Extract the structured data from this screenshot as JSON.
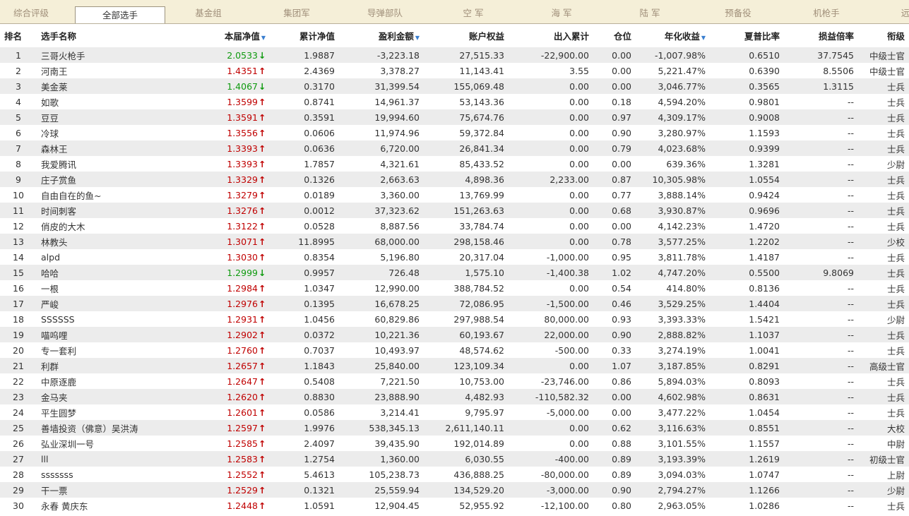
{
  "tabs": [
    {
      "label": "综合评级",
      "active": false
    },
    {
      "label": "全部选手",
      "active": true
    },
    {
      "label": "基金组",
      "active": false
    },
    {
      "label": "集团军",
      "active": false
    },
    {
      "label": "导弹部队",
      "active": false
    },
    {
      "label": "空 军",
      "active": false
    },
    {
      "label": "海 军",
      "active": false
    },
    {
      "label": "陆 军",
      "active": false
    },
    {
      "label": "预备役",
      "active": false
    },
    {
      "label": "机枪手",
      "active": false
    },
    {
      "label": "远",
      "active": false
    }
  ],
  "columns": {
    "rank": "排名",
    "name": "选手名称",
    "nav": "本届净值",
    "cum_nav": "累计净值",
    "profit": "盈利金额",
    "equity": "账户权益",
    "inout": "出入累计",
    "position": "仓位",
    "annual": "年化收益",
    "sharpe": "夏普比率",
    "pl_ratio": "损益倍率",
    "title": "衔级"
  },
  "sort_icon": "▼",
  "colors": {
    "up": "#c00000",
    "down": "#0f9a0f",
    "tab_bg": "#f5efd8",
    "row_alt": "#ececec"
  },
  "rows": [
    {
      "rank": "1",
      "name": "三哥火枪手",
      "nav": "2.0533",
      "dir": "down",
      "cum_nav": "1.9887",
      "profit": "-3,223.18",
      "equity": "27,515.33",
      "inout": "-22,900.00",
      "position": "0.00",
      "annual": "-1,007.98%",
      "sharpe": "0.6510",
      "pl_ratio": "37.7545",
      "title": "中级士官"
    },
    {
      "rank": "2",
      "name": "河南王",
      "nav": "1.4351",
      "dir": "up",
      "cum_nav": "2.4369",
      "profit": "3,378.27",
      "equity": "11,143.41",
      "inout": "3.55",
      "position": "0.00",
      "annual": "5,221.47%",
      "sharpe": "0.6390",
      "pl_ratio": "8.5506",
      "title": "中级士官"
    },
    {
      "rank": "3",
      "name": "美金莱",
      "nav": "1.4067",
      "dir": "down",
      "cum_nav": "0.3170",
      "profit": "31,399.54",
      "equity": "155,069.48",
      "inout": "0.00",
      "position": "0.00",
      "annual": "3,046.77%",
      "sharpe": "0.3565",
      "pl_ratio": "1.3115",
      "title": "士兵"
    },
    {
      "rank": "4",
      "name": "如歌",
      "nav": "1.3599",
      "dir": "up",
      "cum_nav": "0.8741",
      "profit": "14,961.37",
      "equity": "53,143.36",
      "inout": "0.00",
      "position": "0.18",
      "annual": "4,594.20%",
      "sharpe": "0.9801",
      "pl_ratio": "--",
      "title": "士兵"
    },
    {
      "rank": "5",
      "name": "豆豆",
      "nav": "1.3591",
      "dir": "up",
      "cum_nav": "0.3591",
      "profit": "19,994.60",
      "equity": "75,674.76",
      "inout": "0.00",
      "position": "0.97",
      "annual": "4,309.17%",
      "sharpe": "0.9008",
      "pl_ratio": "--",
      "title": "士兵"
    },
    {
      "rank": "6",
      "name": "冷球",
      "nav": "1.3556",
      "dir": "up",
      "cum_nav": "0.0606",
      "profit": "11,974.96",
      "equity": "59,372.84",
      "inout": "0.00",
      "position": "0.90",
      "annual": "3,280.97%",
      "sharpe": "1.1593",
      "pl_ratio": "--",
      "title": "士兵"
    },
    {
      "rank": "7",
      "name": "森林王",
      "nav": "1.3393",
      "dir": "up",
      "cum_nav": "0.0636",
      "profit": "6,720.00",
      "equity": "26,841.34",
      "inout": "0.00",
      "position": "0.79",
      "annual": "4,023.68%",
      "sharpe": "0.9399",
      "pl_ratio": "--",
      "title": "士兵"
    },
    {
      "rank": "8",
      "name": "我爱腾讯",
      "nav": "1.3393",
      "dir": "up",
      "cum_nav": "1.7857",
      "profit": "4,321.61",
      "equity": "85,433.52",
      "inout": "0.00",
      "position": "0.00",
      "annual": "639.36%",
      "sharpe": "1.3281",
      "pl_ratio": "--",
      "title": "少尉"
    },
    {
      "rank": "9",
      "name": "庄子赏鱼",
      "nav": "1.3329",
      "dir": "up",
      "cum_nav": "0.1326",
      "profit": "2,663.63",
      "equity": "4,898.36",
      "inout": "2,233.00",
      "position": "0.87",
      "annual": "10,305.98%",
      "sharpe": "1.0554",
      "pl_ratio": "--",
      "title": "士兵"
    },
    {
      "rank": "10",
      "name": "自由自在的鱼~",
      "nav": "1.3279",
      "dir": "up",
      "cum_nav": "0.0189",
      "profit": "3,360.00",
      "equity": "13,769.99",
      "inout": "0.00",
      "position": "0.77",
      "annual": "3,888.14%",
      "sharpe": "0.9424",
      "pl_ratio": "--",
      "title": "士兵"
    },
    {
      "rank": "11",
      "name": "时间刺客",
      "nav": "1.3276",
      "dir": "up",
      "cum_nav": "0.0012",
      "profit": "37,323.62",
      "equity": "151,263.63",
      "inout": "0.00",
      "position": "0.68",
      "annual": "3,930.87%",
      "sharpe": "0.9696",
      "pl_ratio": "--",
      "title": "士兵"
    },
    {
      "rank": "12",
      "name": "俏皮的大木",
      "nav": "1.3122",
      "dir": "up",
      "cum_nav": "0.0528",
      "profit": "8,887.56",
      "equity": "33,784.74",
      "inout": "0.00",
      "position": "0.00",
      "annual": "4,142.23%",
      "sharpe": "1.4720",
      "pl_ratio": "--",
      "title": "士兵"
    },
    {
      "rank": "13",
      "name": "林教头",
      "nav": "1.3071",
      "dir": "up",
      "cum_nav": "11.8995",
      "profit": "68,000.00",
      "equity": "298,158.46",
      "inout": "0.00",
      "position": "0.78",
      "annual": "3,577.25%",
      "sharpe": "1.2202",
      "pl_ratio": "--",
      "title": "少校"
    },
    {
      "rank": "14",
      "name": "alpd",
      "nav": "1.3030",
      "dir": "up",
      "cum_nav": "0.8354",
      "profit": "5,196.80",
      "equity": "20,317.04",
      "inout": "-1,000.00",
      "position": "0.95",
      "annual": "3,811.78%",
      "sharpe": "1.4187",
      "pl_ratio": "--",
      "title": "士兵"
    },
    {
      "rank": "15",
      "name": "哈哈",
      "nav": "1.2999",
      "dir": "down",
      "cum_nav": "0.9957",
      "profit": "726.48",
      "equity": "1,575.10",
      "inout": "-1,400.38",
      "position": "1.02",
      "annual": "4,747.20%",
      "sharpe": "0.5500",
      "pl_ratio": "9.8069",
      "title": "士兵"
    },
    {
      "rank": "16",
      "name": "一根",
      "nav": "1.2984",
      "dir": "up",
      "cum_nav": "1.0347",
      "profit": "12,990.00",
      "equity": "388,784.52",
      "inout": "0.00",
      "position": "0.54",
      "annual": "414.80%",
      "sharpe": "0.8136",
      "pl_ratio": "--",
      "title": "士兵"
    },
    {
      "rank": "17",
      "name": "严峻",
      "nav": "1.2976",
      "dir": "up",
      "cum_nav": "0.1395",
      "profit": "16,678.25",
      "equity": "72,086.95",
      "inout": "-1,500.00",
      "position": "0.46",
      "annual": "3,529.25%",
      "sharpe": "1.4404",
      "pl_ratio": "--",
      "title": "士兵"
    },
    {
      "rank": "18",
      "name": "SSSSSS",
      "nav": "1.2931",
      "dir": "up",
      "cum_nav": "1.0456",
      "profit": "60,829.86",
      "equity": "297,988.54",
      "inout": "80,000.00",
      "position": "0.93",
      "annual": "3,393.33%",
      "sharpe": "1.5421",
      "pl_ratio": "--",
      "title": "少尉"
    },
    {
      "rank": "19",
      "name": "喵呜哩",
      "nav": "1.2902",
      "dir": "up",
      "cum_nav": "0.0372",
      "profit": "10,221.36",
      "equity": "60,193.67",
      "inout": "22,000.00",
      "position": "0.90",
      "annual": "2,888.82%",
      "sharpe": "1.1037",
      "pl_ratio": "--",
      "title": "士兵"
    },
    {
      "rank": "20",
      "name": "专一套利",
      "nav": "1.2760",
      "dir": "up",
      "cum_nav": "0.7037",
      "profit": "10,493.97",
      "equity": "48,574.62",
      "inout": "-500.00",
      "position": "0.33",
      "annual": "3,274.19%",
      "sharpe": "1.0041",
      "pl_ratio": "--",
      "title": "士兵"
    },
    {
      "rank": "21",
      "name": "利群",
      "nav": "1.2657",
      "dir": "up",
      "cum_nav": "1.1843",
      "profit": "25,840.00",
      "equity": "123,109.34",
      "inout": "0.00",
      "position": "1.07",
      "annual": "3,187.85%",
      "sharpe": "0.8291",
      "pl_ratio": "--",
      "title": "高级士官"
    },
    {
      "rank": "22",
      "name": "中原逐鹿",
      "nav": "1.2647",
      "dir": "up",
      "cum_nav": "0.5408",
      "profit": "7,221.50",
      "equity": "10,753.00",
      "inout": "-23,746.00",
      "position": "0.86",
      "annual": "5,894.03%",
      "sharpe": "0.8093",
      "pl_ratio": "--",
      "title": "士兵"
    },
    {
      "rank": "23",
      "name": "金马夹",
      "nav": "1.2620",
      "dir": "up",
      "cum_nav": "0.8830",
      "profit": "23,888.90",
      "equity": "4,482.93",
      "inout": "-110,582.32",
      "position": "0.00",
      "annual": "4,602.98%",
      "sharpe": "0.8631",
      "pl_ratio": "--",
      "title": "士兵"
    },
    {
      "rank": "24",
      "name": "平生圆梦",
      "nav": "1.2601",
      "dir": "up",
      "cum_nav": "0.0586",
      "profit": "3,214.41",
      "equity": "9,795.97",
      "inout": "-5,000.00",
      "position": "0.00",
      "annual": "3,477.22%",
      "sharpe": "1.0454",
      "pl_ratio": "--",
      "title": "士兵"
    },
    {
      "rank": "25",
      "name": "善墙投资（佛意）吴洪涛",
      "nav": "1.2597",
      "dir": "up",
      "cum_nav": "1.9976",
      "profit": "538,345.13",
      "equity": "2,611,140.11",
      "inout": "0.00",
      "position": "0.62",
      "annual": "3,116.63%",
      "sharpe": "0.8551",
      "pl_ratio": "--",
      "title": "大校"
    },
    {
      "rank": "26",
      "name": "弘业深圳一号",
      "nav": "1.2585",
      "dir": "up",
      "cum_nav": "2.4097",
      "profit": "39,435.90",
      "equity": "192,014.89",
      "inout": "0.00",
      "position": "0.88",
      "annual": "3,101.55%",
      "sharpe": "1.1557",
      "pl_ratio": "--",
      "title": "中尉"
    },
    {
      "rank": "27",
      "name": "lll",
      "nav": "1.2583",
      "dir": "up",
      "cum_nav": "1.2754",
      "profit": "1,360.00",
      "equity": "6,030.55",
      "inout": "-400.00",
      "position": "0.89",
      "annual": "3,193.39%",
      "sharpe": "1.2619",
      "pl_ratio": "--",
      "title": "初级士官"
    },
    {
      "rank": "28",
      "name": "sssssss",
      "nav": "1.2552",
      "dir": "up",
      "cum_nav": "5.4613",
      "profit": "105,238.73",
      "equity": "436,888.25",
      "inout": "-80,000.00",
      "position": "0.89",
      "annual": "3,094.03%",
      "sharpe": "1.0747",
      "pl_ratio": "--",
      "title": "上尉"
    },
    {
      "rank": "29",
      "name": "干一票",
      "nav": "1.2529",
      "dir": "up",
      "cum_nav": "0.1321",
      "profit": "25,559.94",
      "equity": "134,529.20",
      "inout": "-3,000.00",
      "position": "0.90",
      "annual": "2,794.27%",
      "sharpe": "1.1266",
      "pl_ratio": "--",
      "title": "少尉"
    },
    {
      "rank": "30",
      "name": "永春 黄庆东",
      "nav": "1.2448",
      "dir": "up",
      "cum_nav": "1.0591",
      "profit": "12,904.45",
      "equity": "52,955.92",
      "inout": "-12,100.00",
      "position": "0.80",
      "annual": "2,963.05%",
      "sharpe": "1.0286",
      "pl_ratio": "--",
      "title": "士兵"
    }
  ]
}
